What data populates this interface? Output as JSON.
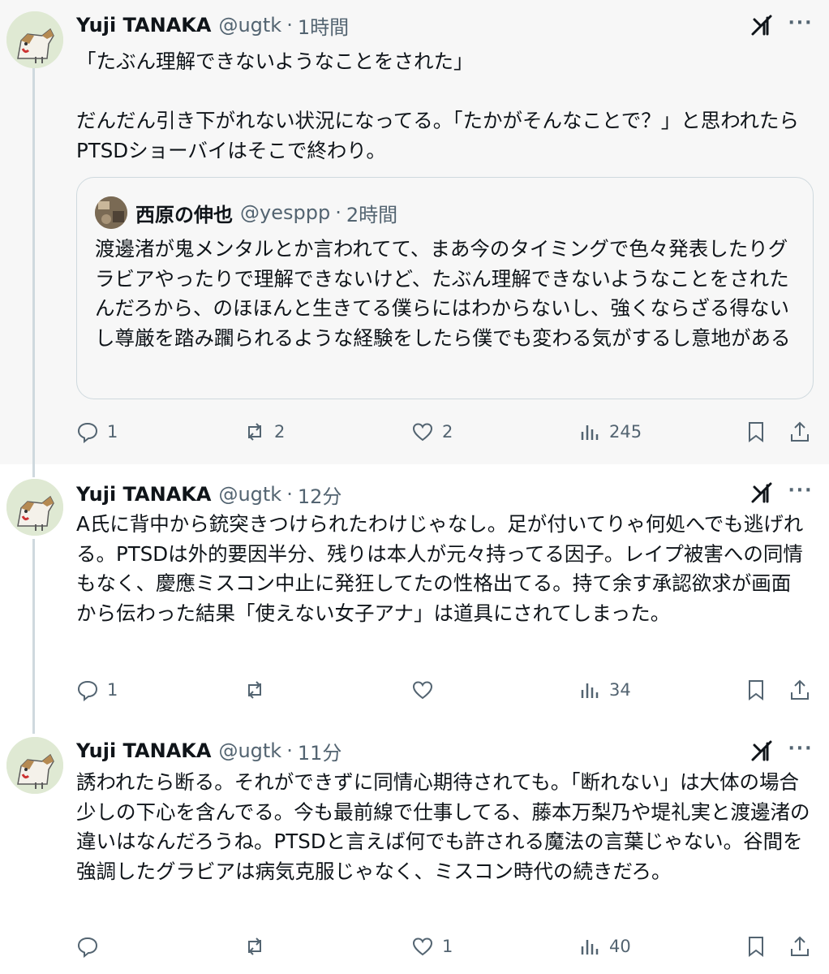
{
  "tweets": [
    {
      "author": "Yuji TANAKA",
      "handle": "@ugtk",
      "separator": "·",
      "time": "1時間",
      "text": "「たぶん理解できないようなことをされた」\n\nだんだん引き下がれない状況になってる。「たかがそんなことで？」と思われたらPTSDショーバイはそこで終わり。",
      "quote": {
        "author": "西原の伸也",
        "handle": "@yesppp",
        "separator": "·",
        "time": "2時間",
        "text": "渡邊渚が鬼メンタルとか言われてて、まあ今のタイミングで色々発表したりグラビアやったりで理解できないけど、たぶん理解できないようなことをされたんだろから、のほほんと生きてる僕らにはわからないし、強くならざる得ないし尊厳を踏み躙られるような経験をしたら僕でも変わる気がするし意地がある"
      },
      "replies": "1",
      "reposts": "2",
      "likes": "2",
      "views": "245"
    },
    {
      "author": "Yuji TANAKA",
      "handle": "@ugtk",
      "separator": "·",
      "time": "12分",
      "text": "A氏に背中から銃突きつけられたわけじゃなし。足が付いてりゃ何処へでも逃げれる。PTSDは外的要因半分、残りは本人が元々持ってる因子。レイプ被害への同情もなく、慶應ミスコン中止に発狂してたの性格出てる。持て余す承認欲求が画面から伝わった結果「使えない女子アナ」は道具にされてしまった。",
      "replies": "1",
      "reposts": "",
      "likes": "",
      "views": "34"
    },
    {
      "author": "Yuji TANAKA",
      "handle": "@ugtk",
      "separator": "·",
      "time": "11分",
      "text": "誘われたら断る。それができずに同情心期待されても。「断れない」は大体の場合少しの下心を含んでる。今も最前線で仕事してる、藤本万梨乃や堤礼実と渡邊渚の違いはなんだろうね。PTSDと言えば何でも許される魔法の言葉じゃない。谷間を強調したグラビアは病気克服じゃなく、ミスコン時代の続きだろ。",
      "replies": "",
      "reposts": "",
      "likes": "1",
      "views": "40"
    }
  ],
  "icons": {
    "avatar": "dog-avatar-icon",
    "grok": "grok-icon",
    "more": "more-icon",
    "more_glyph": "···",
    "reply": "reply-icon",
    "repost": "repost-icon",
    "like": "heart-icon",
    "views": "views-icon",
    "bookmark": "bookmark-icon",
    "share": "share-icon"
  },
  "colors": {
    "highlight_bg": "#f7f7f7",
    "text": "#0f1419",
    "secondary": "#536471",
    "border": "#cfd9de"
  }
}
